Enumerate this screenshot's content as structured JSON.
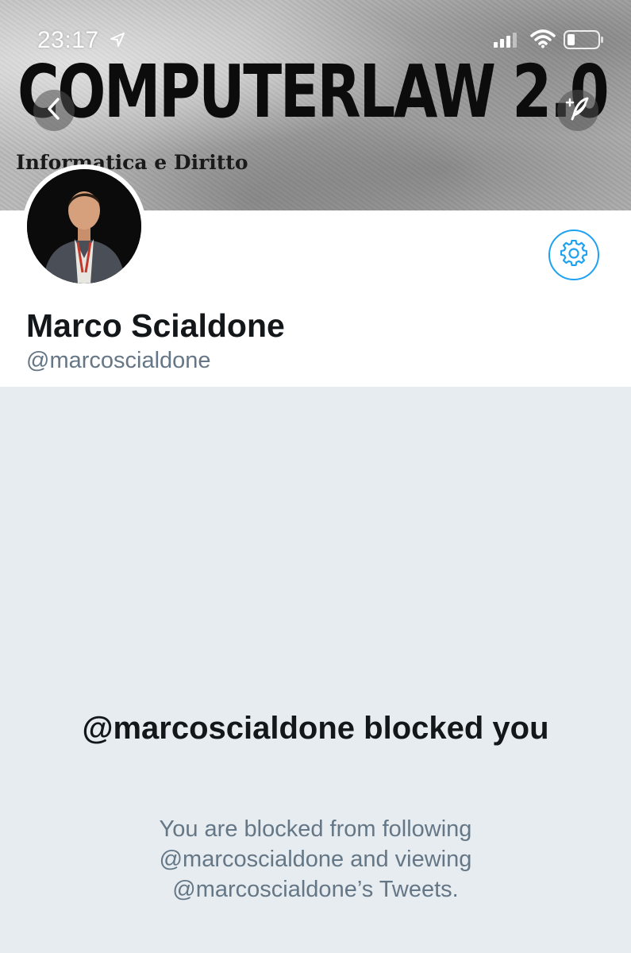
{
  "status_bar": {
    "time": "23:17",
    "icons": [
      "location-arrow-icon",
      "cellular-signal-icon",
      "wifi-icon",
      "battery-icon"
    ]
  },
  "banner": {
    "title": "COMPUTERLAW 2.0",
    "subtitle": "Informatica e Diritto"
  },
  "nav": {
    "back_icon": "chevron-left-icon",
    "compose_icon": "compose-tweet-icon"
  },
  "profile": {
    "display_name": "Marco Scialdone",
    "handle": "@marcoscialdone",
    "settings_icon": "gear-icon"
  },
  "blocked": {
    "title": "@marcoscialdone blocked you",
    "line1": "You are blocked from following",
    "line2": "@marcoscialdone and viewing",
    "line3": "@marcoscialdone’s Tweets."
  },
  "colors": {
    "accent": "#1da1f2",
    "background": "#e6ecf0",
    "primary_text": "#14171a",
    "secondary_text": "#657786"
  }
}
